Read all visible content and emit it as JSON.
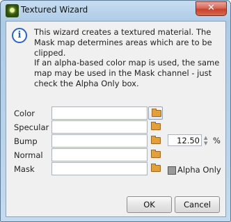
{
  "window": {
    "title": "Textured Wizard",
    "close_glyph": "✕",
    "app_icon": "textured-wizard-icon"
  },
  "info": {
    "icon": "info-icon",
    "icon_glyph": "i",
    "message_1": "This wizard creates a textured material. The Mask map determines areas which are to be clipped.",
    "message_2": "If an alpha-based color map is used, the same map may be used in the Mask channel - just check the Alpha Only box."
  },
  "fields": [
    {
      "label": "Color",
      "value": ""
    },
    {
      "label": "Specular",
      "value": ""
    },
    {
      "label": "Bump",
      "value": ""
    },
    {
      "label": "Normal",
      "value": ""
    },
    {
      "label": "Mask",
      "value": ""
    }
  ],
  "bump_amount": {
    "value": "12.50",
    "unit": "%"
  },
  "alpha_only": {
    "label": "Alpha Only",
    "checked": false
  },
  "buttons": {
    "ok": "OK",
    "cancel": "Cancel"
  }
}
